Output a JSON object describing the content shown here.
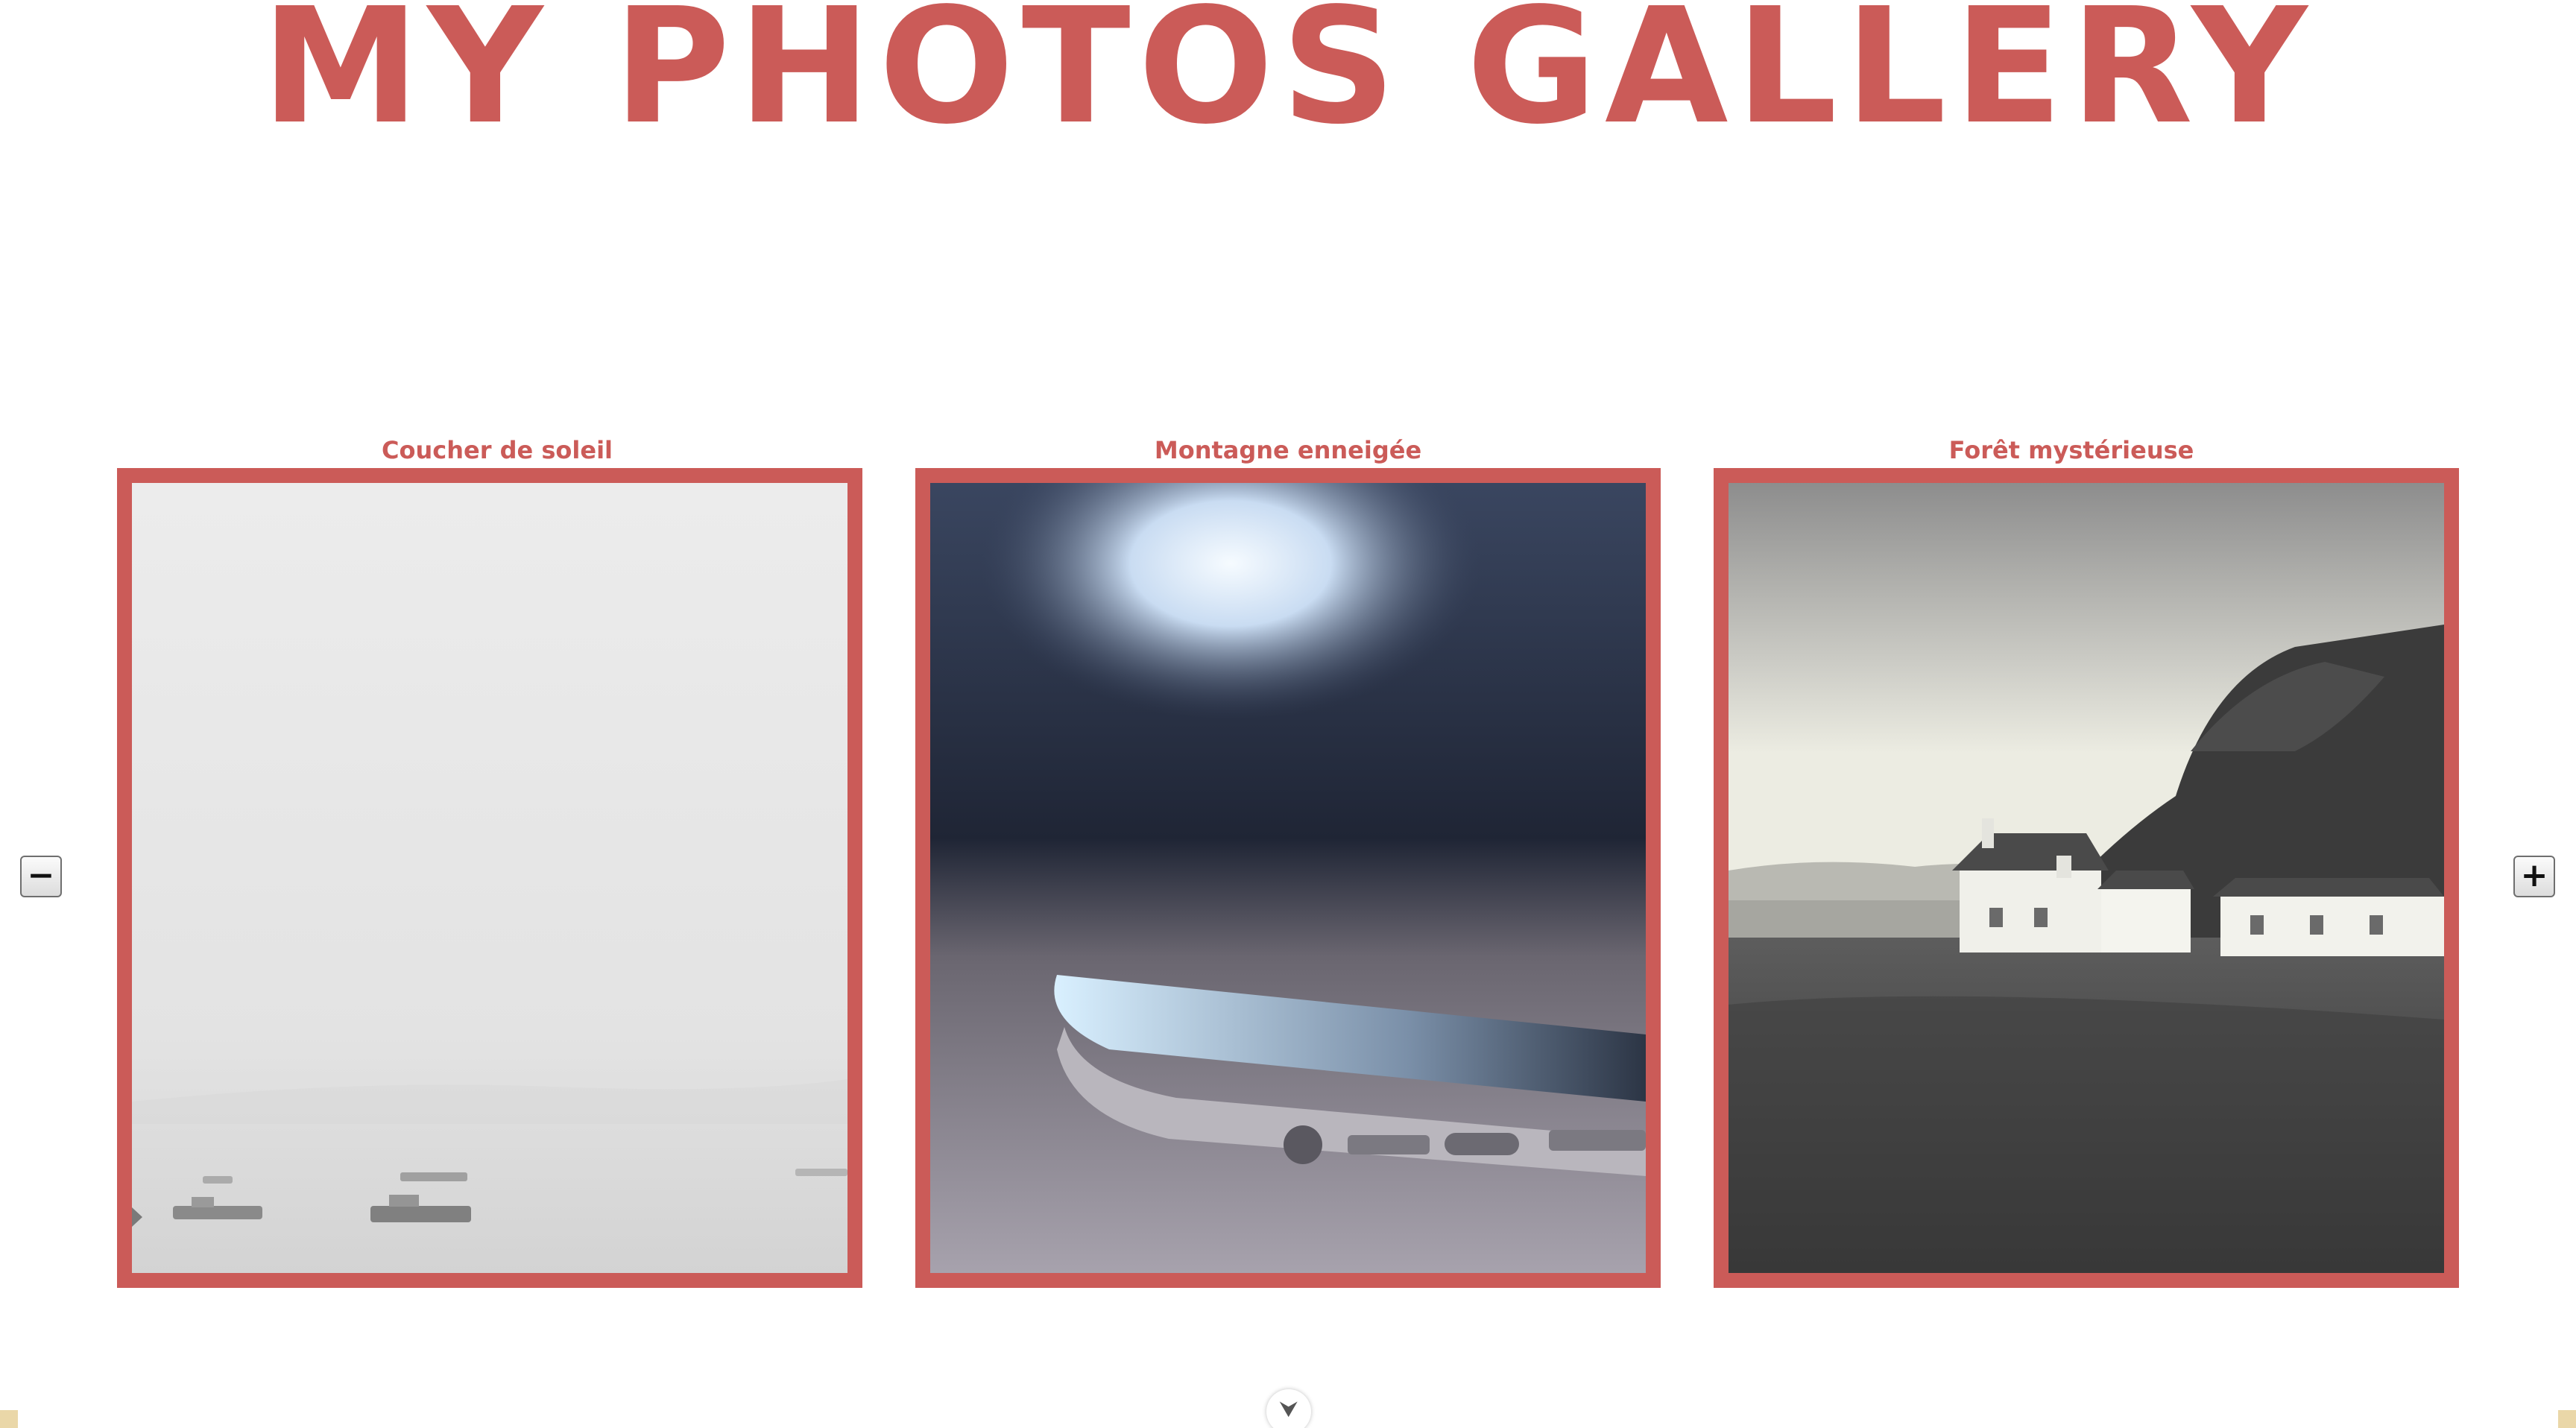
{
  "page": {
    "title": "My Photos Gallery"
  },
  "gallery": {
    "cards": [
      {
        "caption": "Coucher de soleil",
        "image": "foggy-sea-boats-photo"
      },
      {
        "caption": "Montagne enneigée",
        "image": "smartphone-closeup-photo"
      },
      {
        "caption": "Forêt mystérieuse",
        "image": "coastal-cottages-cliff-photo"
      }
    ],
    "prev_label": "−",
    "next_label": "+",
    "scroll_hint_icon": "chevron-down-icon",
    "scroll_hint_glyph": "⮟"
  },
  "colors": {
    "accent": "#cb5b58",
    "background": "#ffffff"
  }
}
